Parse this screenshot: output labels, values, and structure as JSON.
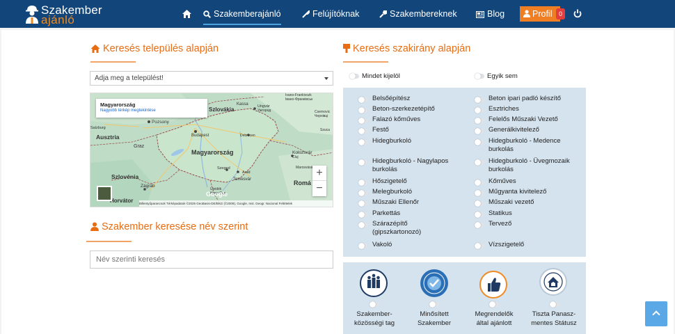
{
  "brand": {
    "line1": "Szakember",
    "line2": "ajánló",
    "icon": "worker-icon"
  },
  "nav": {
    "home_icon": "home-icon",
    "items": [
      {
        "label": "Szakemberajánló",
        "icon": "search-icon",
        "active": true
      },
      {
        "label": "Felújítóknak",
        "icon": "wrench-icon"
      },
      {
        "label": "Szakembereknek",
        "icon": "wrench-icon"
      },
      {
        "label": "Blog",
        "icon": "newspaper-icon"
      }
    ],
    "profile_label": "Profil",
    "profile_badge": "0",
    "power_icon": "power-icon"
  },
  "location_search": {
    "title": "Keresés település alapján",
    "select_placeholder": "Adja meg a települést!",
    "map": {
      "infobox_title": "Magyarország",
      "infobox_link": "Nagyobb térkép megtekintése",
      "labels": [
        "Ivano-Frankivszk",
        "Івано-Франківськ",
        "Szlovákia",
        "Kassa",
        "Ungvár",
        "Ужгород",
        "Csernovic",
        "Чернівці",
        "Salzburg",
        "Pozsony",
        "Ausztria",
        "Graz",
        "Budapest",
        "Debrecen",
        "Szuca",
        "Magyarország",
        "Kolozsvár",
        "Cluj",
        "Szeged",
        "Arad",
        "Marosvásárhely",
        "Szlovénia",
        "Temesvár",
        "Zágráb",
        "Romá",
        "Újvidék",
        "Horvátor",
        "Нови Сад"
      ],
      "google": "Google",
      "attribution": "Billentyűparancsok   Térképadatok ©2025 GeoBasis-DE/BKG (©2009), Google, Inst. Geogr. Nacional   Feltételek",
      "zoom_in": "+",
      "zoom_out": "−"
    }
  },
  "name_search": {
    "title": "Szakember keresése név szerint",
    "placeholder": "Név szerinti keresés"
  },
  "specialty_search": {
    "title": "Keresés szakirány alapján",
    "select_all": "Mindet kijelöl",
    "select_none": "Egyik sem",
    "left_items": [
      "Belsőépítész",
      "Beton-szerkezetépítő",
      "Falazó kőműves",
      "Festő",
      "Hidegburkoló",
      "Hidegburkoló - Nagylapos burkolás",
      "Hőszigetelő",
      "Melegburkoló",
      "Műszaki Ellenőr",
      "Parkettás",
      "Szárazépítő (gipszkartonozó)",
      "Vakoló"
    ],
    "right_items": [
      "Beton ipari padló készítő",
      "Esztriches",
      "Felelős Műszaki Vezető",
      "Generálkivitelező",
      "Hidegburkoló - Medence burkolás",
      "Hidegburkoló - Üvegmozaik burkolás",
      "Kőműves",
      "Műgyanta kivitelező",
      "Műszaki vezető",
      "Statikus",
      "Tervező",
      "Vízszigetelő"
    ],
    "certificates": [
      {
        "line1": "Szakember-",
        "line2": "közösségi tag",
        "icon": "community-icon"
      },
      {
        "line1": "Minősített",
        "line2": "Szakember",
        "icon": "certified-icon"
      },
      {
        "line1": "Megrendelők",
        "line2": "által ajánlott",
        "icon": "thumbs-up-icon"
      },
      {
        "line1": "Tiszta Panasz-",
        "line2": "mentes Státusz",
        "icon": "house-shield-icon"
      }
    ]
  },
  "colors": {
    "navbar": "#12467a",
    "accent": "#e86c12",
    "panel_blue": "#d5e3ee",
    "badge": "#e43d3d",
    "scroll_top": "#5aa9e6"
  }
}
